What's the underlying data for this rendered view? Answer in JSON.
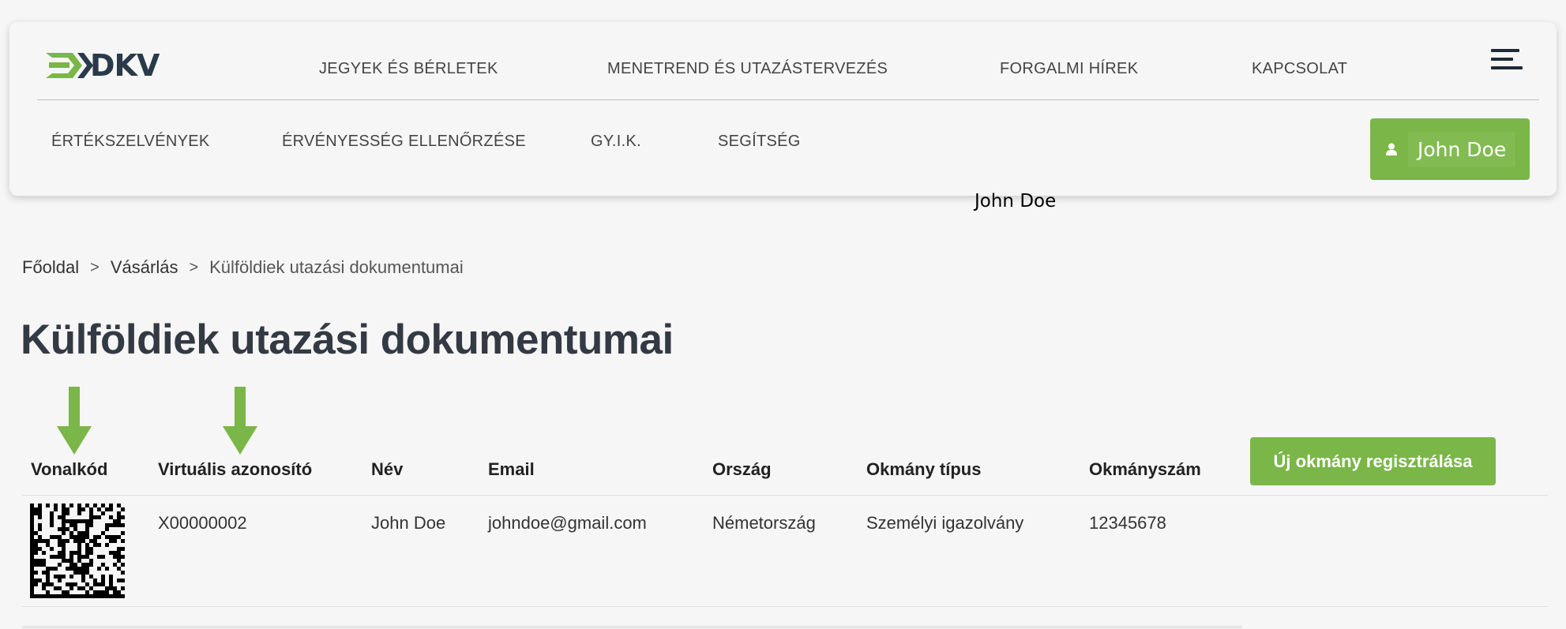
{
  "header": {
    "logo_text": "DKV",
    "top_nav": [
      {
        "label": "JEGYEK ÉS BÉRLETEK"
      },
      {
        "label": "MENETREND ÉS UTAZÁSTERVEZÉS"
      },
      {
        "label": "FORGALMI HÍREK"
      },
      {
        "label": "KAPCSOLAT"
      }
    ],
    "sub_nav": [
      {
        "label": "ÉRTÉKSZELVÉNYEK"
      },
      {
        "label": "ÉRVÉNYESSÉG ELLENŐRZÉSE"
      },
      {
        "label": "GY.I.K."
      },
      {
        "label": "SEGÍTSÉG"
      }
    ],
    "user_button_label": "John Doe",
    "user_label": "John Doe"
  },
  "breadcrumb": {
    "items": [
      "Főoldal",
      "Vásárlás",
      "Külföldiek utazási dokumentumai"
    ],
    "separator": ">"
  },
  "page_title": "Külföldiek utazási dokumentumai",
  "table": {
    "headers": [
      "Vonalkód",
      "Virtuális azonosító",
      "Név",
      "Email",
      "Ország",
      "Okmány típus",
      "Okmányszám"
    ],
    "new_button_label": "Új okmány regisztrálása",
    "rows": [
      {
        "virtual_id": "X00000002",
        "name": "John Doe",
        "email": "johndoe@gmail.com",
        "country": "Németország",
        "doc_type": "Személyi igazolvány",
        "doc_number": "12345678"
      }
    ]
  },
  "colors": {
    "accent_green": "#7ab648",
    "text_dark": "#333333",
    "logo_dark": "#2b3a4a"
  },
  "icons": {
    "logo_mark": "green-arrows-icon",
    "menu": "hamburger-menu-icon",
    "user": "user-icon",
    "arrow": "arrow-down-icon",
    "barcode": "datamatrix-barcode-icon"
  }
}
